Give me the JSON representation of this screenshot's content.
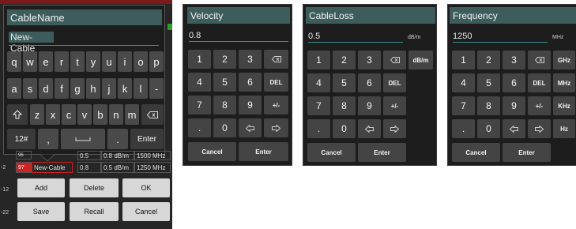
{
  "cable_panel": {
    "title": "CableName",
    "value": "New-Cable",
    "keyboard": {
      "row1": [
        "q",
        "w",
        "e",
        "r",
        "t",
        "y",
        "u",
        "i",
        "o",
        "p"
      ],
      "row2": [
        "a",
        "s",
        "d",
        "f",
        "g",
        "h",
        "j",
        "k",
        "l",
        "-"
      ],
      "row3": [
        "z",
        "x",
        "c",
        "v",
        "b",
        "n",
        "m"
      ],
      "mode_key": "12#",
      "comma_key": ",",
      "period_key": ".",
      "enter_key": "Enter"
    },
    "table_rows": [
      {
        "index": "96",
        "name": "",
        "vel": "0.5",
        "loss": "0.8 dB/m",
        "freq": "1500 MHz"
      },
      {
        "index": "97",
        "name": "New-Cable",
        "vel": "0.8",
        "loss": "0.5 dB/m",
        "freq": "1250 MHz"
      }
    ],
    "buttons": [
      "Add",
      "Delete",
      "OK",
      "Save",
      "Recall",
      "Cancel"
    ],
    "side_ticks": [
      "-2",
      "-12",
      "-22"
    ]
  },
  "velocity_panel": {
    "title": "Velocity",
    "value": "0.8",
    "keys": [
      "1",
      "2",
      "3",
      "4",
      "5",
      "6",
      "DEL",
      "7",
      "8",
      "9",
      "+/-",
      ".",
      "0"
    ],
    "cancel": "Cancel",
    "enter": "Enter"
  },
  "cableloss_panel": {
    "title": "CableLoss",
    "value": "0.5",
    "unit": "dB/m",
    "keys": [
      "1",
      "2",
      "3",
      "4",
      "5",
      "6",
      "DEL",
      "7",
      "8",
      "9",
      "+/-",
      ".",
      "0"
    ],
    "unit_key": "dB/m",
    "cancel": "Cancel",
    "enter": "Enter"
  },
  "frequency_panel": {
    "title": "Frequency",
    "value": "1250",
    "unit": "MHz",
    "keys": [
      "1",
      "2",
      "3",
      "4",
      "5",
      "6",
      "DEL",
      "7",
      "8",
      "9",
      "+/-",
      ".",
      "0"
    ],
    "unit_keys": [
      "GHz",
      "MHz",
      "KHz",
      "Hz"
    ],
    "cancel": "Cancel",
    "enter": "Enter"
  },
  "colors": {
    "title_bar": "#3d5d5d",
    "panel_bg": "#1d1d1d",
    "key_bg": "#444444",
    "accent": "#3f8f8f",
    "selected_row": "#cc2222"
  }
}
